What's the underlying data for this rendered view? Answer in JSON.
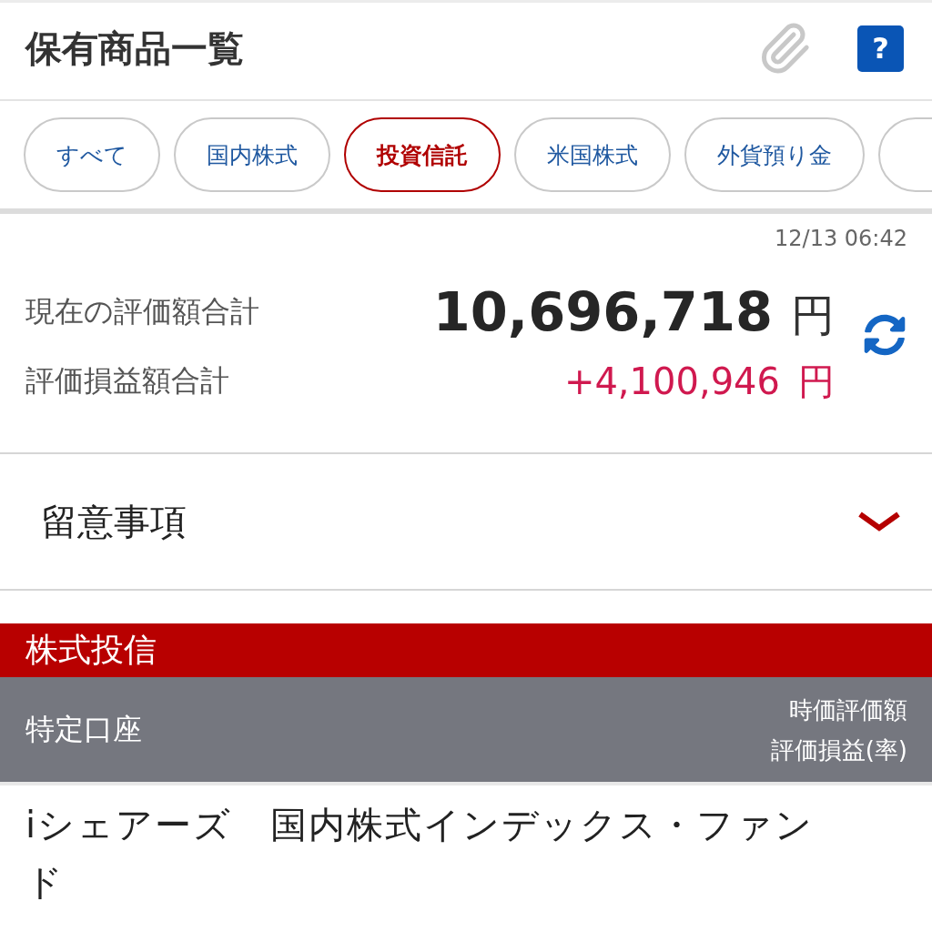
{
  "header": {
    "title": "保有商品一覧",
    "help_label": "?"
  },
  "tabs": [
    {
      "label": "すべて",
      "selected": false
    },
    {
      "label": "国内株式",
      "selected": false
    },
    {
      "label": "投資信託",
      "selected": true
    },
    {
      "label": "米国株式",
      "selected": false
    },
    {
      "label": "外貨預り金",
      "selected": false
    },
    {
      "selected": false
    }
  ],
  "summary": {
    "timestamp": "12/13 06:42",
    "rows": [
      {
        "kind": "total",
        "label": "現在の評価額合計",
        "value": "10,696,718",
        "unit": "円"
      },
      {
        "kind": "gain",
        "label": "評価損益額合計",
        "value": "+4,100,946",
        "unit": "円"
      }
    ]
  },
  "notice": {
    "title": "留意事項",
    "expanded": false
  },
  "section": {
    "title": "株式投信",
    "account": "特定口座",
    "column_headers": [
      "時価評価額",
      "評価損益(率)"
    ]
  },
  "holdings": [
    {
      "name": "iシェアーズ　国内株式インデックス・ファンド"
    }
  ]
}
